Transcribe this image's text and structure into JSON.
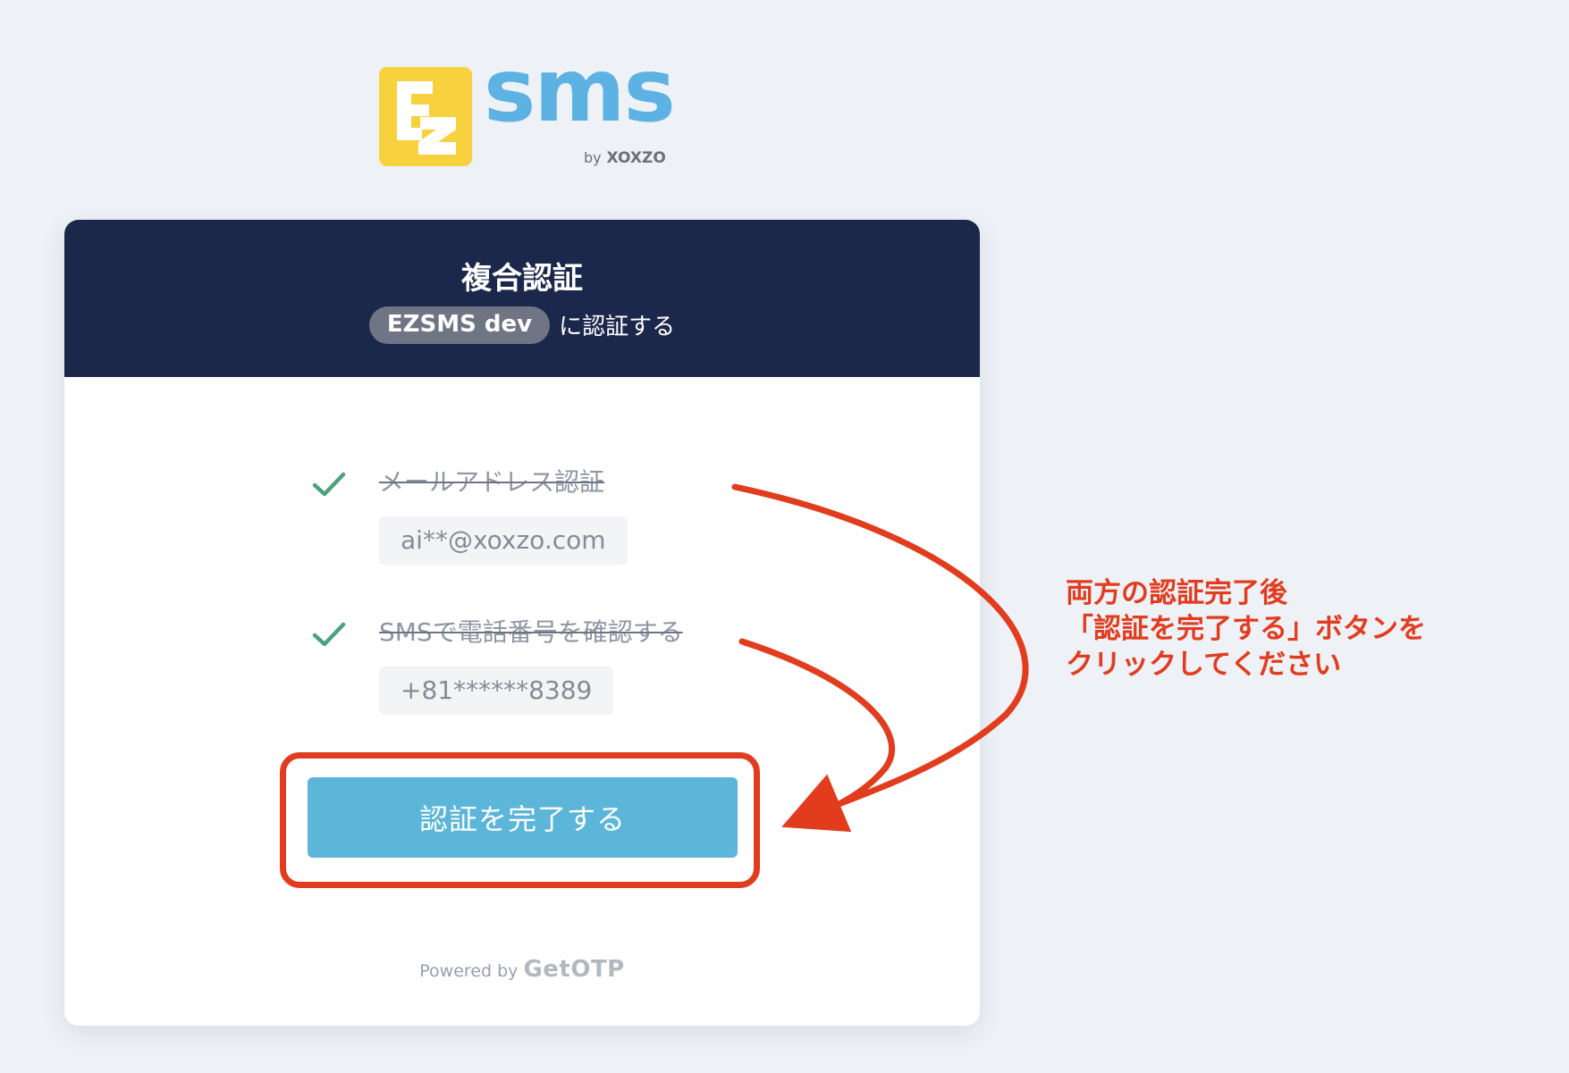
{
  "logo": {
    "word": "sms",
    "by_prefix": "by",
    "by_brand": "XOXZO",
    "brand_color": "#5cb2e3",
    "mark_color": "#f7d23e"
  },
  "header": {
    "title": "複合認証",
    "app_name": "EZSMS dev",
    "subtitle_suffix": "に認証する",
    "background": "#1c284b"
  },
  "steps": [
    {
      "label": "メールアドレス認証",
      "value": "ai**@xoxzo.com",
      "status": "done",
      "icon": "check-icon"
    },
    {
      "label": "SMSで電話番号を確認する",
      "value": "+81******8389",
      "status": "done",
      "icon": "check-icon"
    }
  ],
  "button": {
    "label": "認証を完了する",
    "color": "#5bb6d9"
  },
  "footer": {
    "prefix": "Powered by",
    "brand": "GetOTP"
  },
  "annotation": {
    "lines": [
      "両方の認証完了後",
      "「認証を完了する」ボタンを",
      "クリックしてください"
    ],
    "color": "#e23c1f"
  }
}
